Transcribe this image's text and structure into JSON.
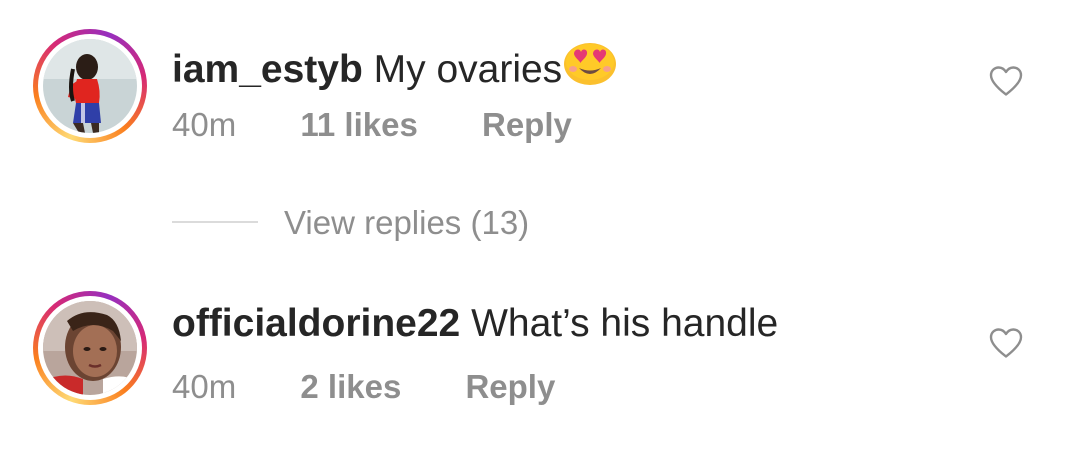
{
  "comments": [
    {
      "username": "iam_estyb",
      "text": "My ovaries",
      "emoji": "smiling-face-with-heart-eyes",
      "time": "40m",
      "likes": "11 likes",
      "reply_label": "Reply",
      "liked": false
    },
    {
      "username": "officialdorine22",
      "text": "What’s his handle",
      "time": "40m",
      "likes": "2 likes",
      "reply_label": "Reply",
      "liked": false
    }
  ],
  "view_replies": {
    "label": "View replies (13)"
  },
  "colors": {
    "text": "#262626",
    "secondary": "#8e8e8e",
    "divider": "#dbdbdb",
    "story_ring_start": "#feda75",
    "story_ring_end": "#962fbf"
  }
}
